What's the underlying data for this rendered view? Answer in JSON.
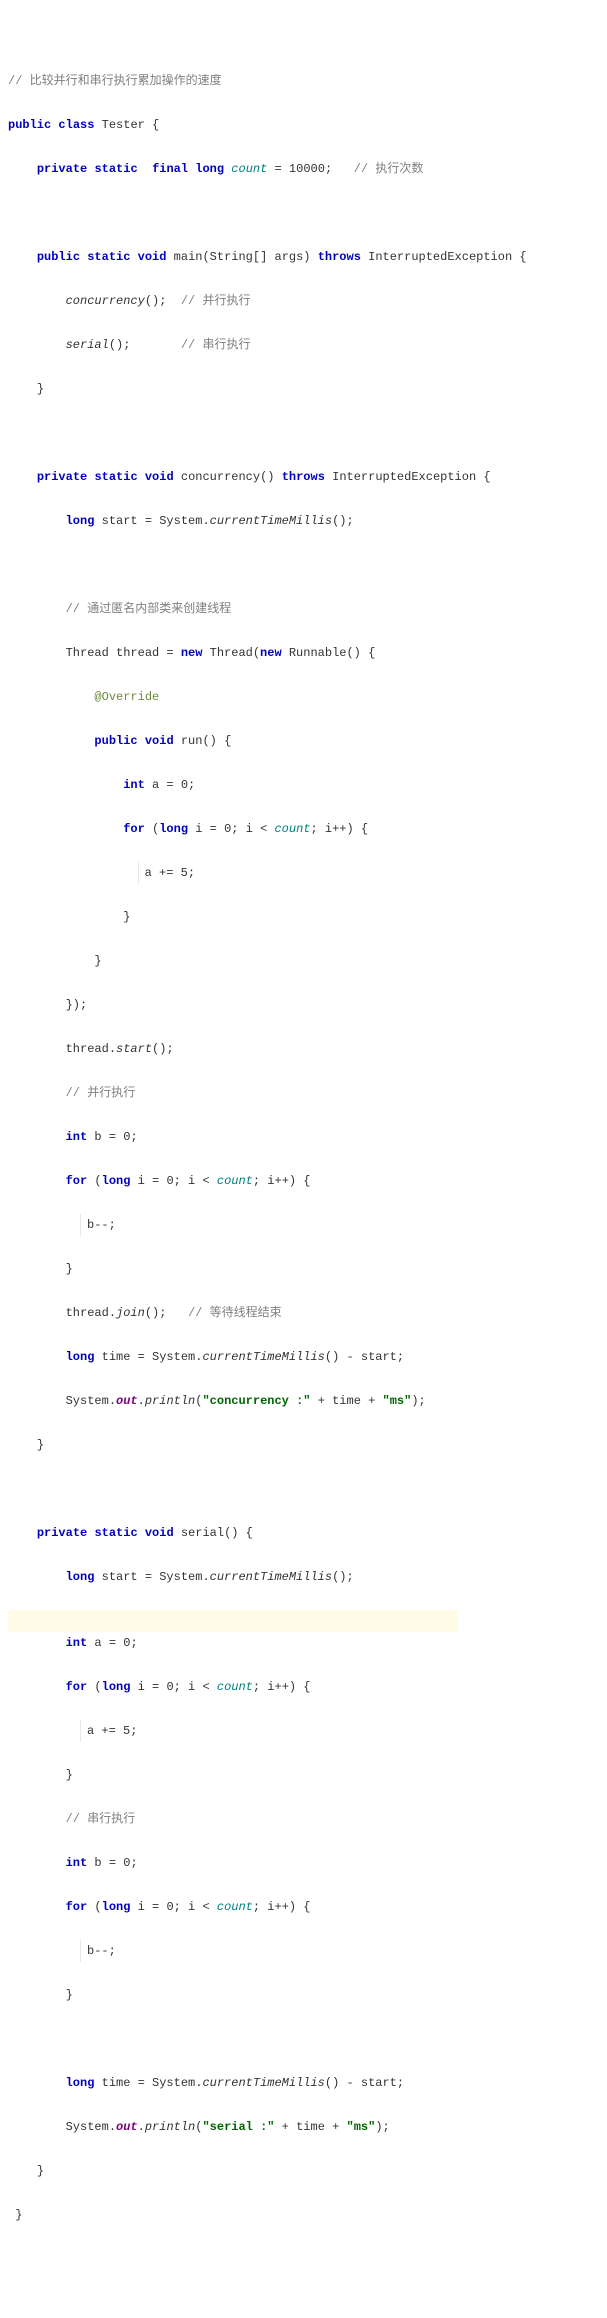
{
  "c1": "// 比较并行和串行执行累加操作的速度",
  "l2_kw1": "public",
  "l2_kw2": "class",
  "l2_name": "Tester {",
  "l3_kw1": "private",
  "l3_kw2": "static",
  "l3_kw3": "final",
  "l3_kw4": "long",
  "l3_fld": "count",
  "l3_eq": " = ",
  "l3_num": "10000",
  "l3_sc": ";",
  "l3_cmt": "// 执行次数",
  "l5_kw1": "public",
  "l5_kw2": "static",
  "l5_kw3": "void",
  "l5_name": "main(String[] args) ",
  "l5_kw4": "throws",
  "l5_exc": " InterruptedException {",
  "l6_call": "concurrency",
  "l6_rest": "();",
  "l6_cmt": "// 并行执行",
  "l7_call": "serial",
  "l7_rest": "();",
  "l7_cmt": "// 串行执行",
  "l8": "}",
  "l10_kw1": "private",
  "l10_kw2": "static",
  "l10_kw3": "void",
  "l10_name": "concurrency() ",
  "l10_kw4": "throws",
  "l10_exc": " InterruptedException {",
  "l11_kw": "long",
  "l11_rest": " start = System.",
  "l11_call": "currentTimeMillis",
  "l11_end": "();",
  "l13_cmt": "// 通过匿名内部类来创建线程",
  "l14_a": "Thread thread = ",
  "l14_kw1": "new",
  "l14_b": " Thread(",
  "l14_kw2": "new",
  "l14_c": " Runnable() {",
  "l15_ann": "@Override",
  "l16_kw1": "public",
  "l16_kw2": "void",
  "l16_rest": " run() {",
  "l17_kw": "int",
  "l17_rest": " a = ",
  "l17_num": "0",
  "l17_sc": ";",
  "l18_kw1": "for",
  "l18_a": " (",
  "l18_kw2": "long",
  "l18_b": " i = ",
  "l18_num": "0",
  "l18_c": "; i < ",
  "l18_fld": "count",
  "l18_d": "; i++) {",
  "l19": "a += ",
  "l19_num": "5",
  "l19_sc": ";",
  "l20": "}",
  "l21": "}",
  "l22": "});",
  "l23_a": "thread.",
  "l23_call": "start",
  "l23_b": "();",
  "l24_cmt": "// 并行执行",
  "l25_kw": "int",
  "l25_rest": " b = ",
  "l25_num": "0",
  "l25_sc": ";",
  "l26_kw1": "for",
  "l26_a": " (",
  "l26_kw2": "long",
  "l26_b": " i = ",
  "l26_num": "0",
  "l26_c": "; i < ",
  "l26_fld": "count",
  "l26_d": "; i++) {",
  "l27": "b--;",
  "l28": "}",
  "l29_a": "thread.",
  "l29_call": "join",
  "l29_b": "();",
  "l29_cmt": "// 等待线程结束",
  "l30_kw": "long",
  "l30_a": " time = System.",
  "l30_call": "currentTimeMillis",
  "l30_b": "() - start;",
  "l31_a": "System.",
  "l31_sf": "out",
  "l31_b": ".",
  "l31_call": "println",
  "l31_c": "(",
  "l31_s1": "\"concurrency :\"",
  "l31_d": " + time + ",
  "l31_s2": "\"ms\"",
  "l31_e": ");",
  "l32": "}",
  "l34_kw1": "private",
  "l34_kw2": "static",
  "l34_kw3": "void",
  "l34_rest": " serial() {",
  "l35_kw": "long",
  "l35_a": " start = System.",
  "l35_call": "currentTimeMillis",
  "l35_b": "();",
  "l37_kw": "int",
  "l37_a": " a = ",
  "l37_num": "0",
  "l37_sc": ";",
  "l38_kw1": "for",
  "l38_a": " (",
  "l38_kw2": "long",
  "l38_b": " i = ",
  "l38_num": "0",
  "l38_c": "; i < ",
  "l38_fld": "count",
  "l38_d": "; i++) {",
  "l39": "a += ",
  "l39_num": "5",
  "l39_sc": ";",
  "l40": "}",
  "l41_cmt": "// 串行执行",
  "l42_kw": "int",
  "l42_a": " b = ",
  "l42_num": "0",
  "l42_sc": ";",
  "l43_kw1": "for",
  "l43_a": " (",
  "l43_kw2": "long",
  "l43_b": " i = ",
  "l43_num": "0",
  "l43_c": "; i < ",
  "l43_fld": "count",
  "l43_d": "; i++) {",
  "l44": "b--;",
  "l45": "}",
  "l47_kw": "long",
  "l47_a": " time = System.",
  "l47_call": "currentTimeMillis",
  "l47_b": "() - start;",
  "l48_a": "System.",
  "l48_sf": "out",
  "l48_b": ".",
  "l48_call": "println",
  "l48_c": "(",
  "l48_s1": "\"serial :\"",
  "l48_d": " + time + ",
  "l48_s2": "\"ms\"",
  "l48_e": ");",
  "l49": "}",
  "l50": "}"
}
